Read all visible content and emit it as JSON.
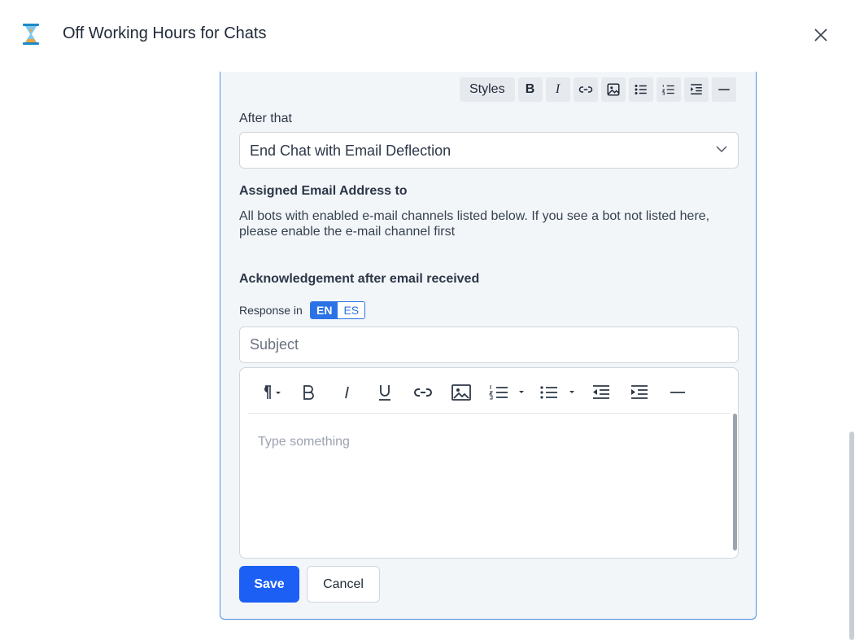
{
  "header": {
    "title": "Off Working Hours for Chats"
  },
  "top_toolbar": {
    "styles_label": "Styles",
    "bold_label": "B",
    "italic_label": "I"
  },
  "after_that": {
    "label": "After that",
    "selected": "End Chat with Email Deflection"
  },
  "assigned": {
    "heading": "Assigned Email Address to",
    "description": "All bots with enabled e-mail channels listed below. If you see a bot not listed here, please enable the e-mail channel first"
  },
  "acknowledgement": {
    "heading": "Acknowledgement after email received"
  },
  "response": {
    "label": "Response in",
    "languages": [
      "EN",
      "ES"
    ]
  },
  "subject": {
    "placeholder": "Subject",
    "value": ""
  },
  "editor": {
    "placeholder": "Type something",
    "icons": [
      "paragraph-icon",
      "bold-icon",
      "italic-icon",
      "underline-icon",
      "link-icon",
      "image-icon",
      "ordered-list-icon",
      "bullet-list-icon",
      "outdent-icon",
      "indent-icon",
      "horizontal-rule-icon"
    ]
  },
  "buttons": {
    "save": "Save",
    "cancel": "Cancel"
  },
  "colors": {
    "accent": "#1b5ff5",
    "panel_border": "#4a90e2",
    "panel_bg": "#f3f6f9"
  }
}
